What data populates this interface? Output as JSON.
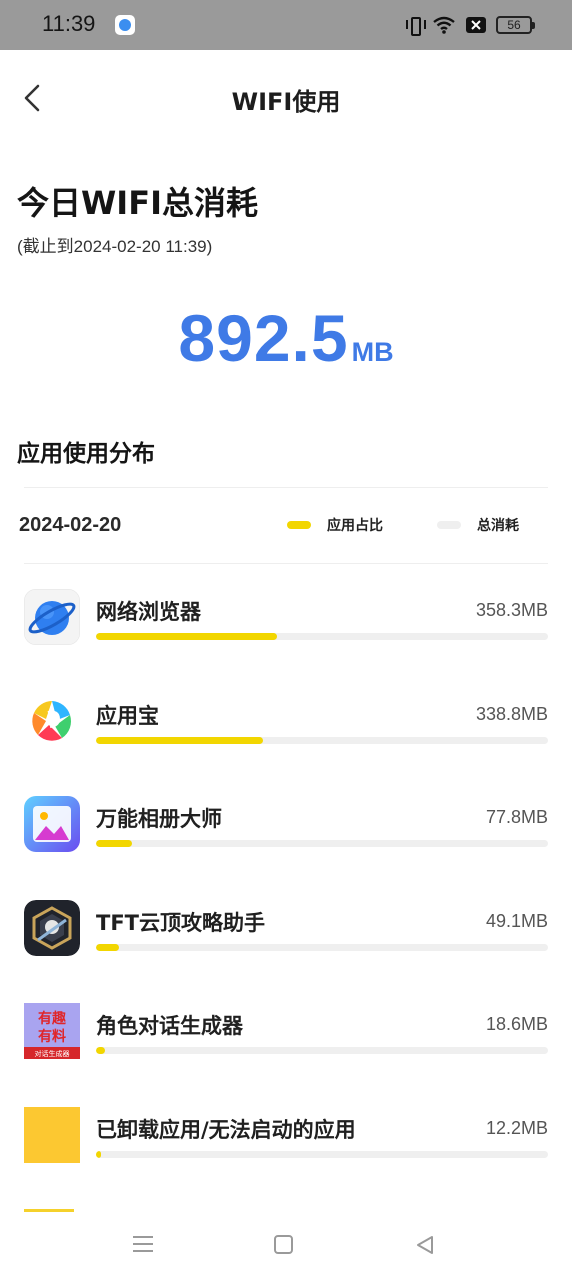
{
  "status_bar": {
    "time": "11:39",
    "battery": "56"
  },
  "header": {
    "title": "WIFI使用"
  },
  "summary": {
    "title": "今日WIFI总消耗",
    "subtitle": "(截止到2024-02-20 11:39)",
    "total_value": "892.5",
    "total_unit": "MB",
    "accent_color": "#3f7ae6"
  },
  "distribution": {
    "title": "应用使用分布",
    "date": "2024-02-20",
    "legend": [
      {
        "label": "应用占比",
        "color": "#f2d600"
      },
      {
        "label": "总消耗",
        "color": "#efefef"
      }
    ]
  },
  "apps": [
    {
      "name": "网络浏览器",
      "size": "358.3MB",
      "share": 0.4,
      "icon": "browser-planet-icon"
    },
    {
      "name": "应用宝",
      "size": "338.8MB",
      "share": 0.37,
      "icon": "app-store-icon"
    },
    {
      "name": "万能相册大师",
      "size": "77.8MB",
      "share": 0.08,
      "icon": "photo-album-icon"
    },
    {
      "name": "TFT云顶攻略助手",
      "size": "49.1MB",
      "share": 0.05,
      "icon": "tft-game-icon"
    },
    {
      "name": "角色对话生成器",
      "size": "18.6MB",
      "share": 0.02,
      "icon": "dialogue-generator-icon"
    },
    {
      "name": "已卸载应用/无法启动的应用",
      "size": "12.2MB",
      "share": 0.01,
      "icon": "uninstalled-app-icon"
    }
  ],
  "dialogue_icon_text": {
    "line1": "有趣",
    "line2": "有料",
    "line3": "对话生成器"
  }
}
